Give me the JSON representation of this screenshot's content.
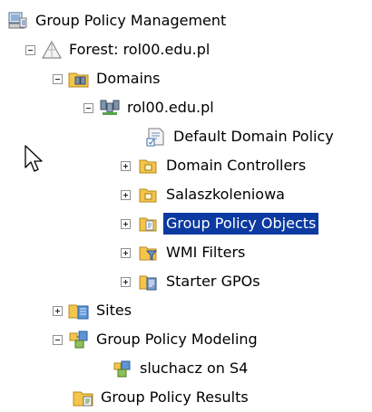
{
  "tree": {
    "root": {
      "label": "Group Policy Management",
      "icon": "gpm-console-icon"
    },
    "forest": {
      "label": "Forest: rol00.edu.pl",
      "icon": "forest-icon"
    },
    "domains": {
      "label": "Domains",
      "icon": "domains-folder-icon"
    },
    "domain": {
      "label": "rol00.edu.pl",
      "icon": "domain-icon"
    },
    "items": [
      {
        "label": "Default Domain Policy",
        "icon": "gpo-link-icon",
        "expandable": false
      },
      {
        "label": "Domain Controllers",
        "icon": "ou-folder-icon",
        "expandable": true
      },
      {
        "label": "Salaszkoleniowa",
        "icon": "ou-folder-icon",
        "expandable": true
      },
      {
        "label": "Group Policy Objects",
        "icon": "gpo-folder-icon",
        "expandable": true,
        "selected": true
      },
      {
        "label": "WMI Filters",
        "icon": "wmi-folder-icon",
        "expandable": true
      },
      {
        "label": "Starter GPOs",
        "icon": "starter-gpo-folder-icon",
        "expandable": true
      }
    ],
    "sites": {
      "label": "Sites",
      "icon": "sites-folder-icon"
    },
    "modeling": {
      "label": "Group Policy Modeling",
      "icon": "modeling-icon"
    },
    "modeling_child": {
      "label": "sluchacz on S4",
      "icon": "modeling-result-icon"
    },
    "results": {
      "label": "Group Policy Results",
      "icon": "results-folder-icon"
    }
  },
  "colors": {
    "selection": "#0b3aa0",
    "folder": "#f3c54b"
  }
}
